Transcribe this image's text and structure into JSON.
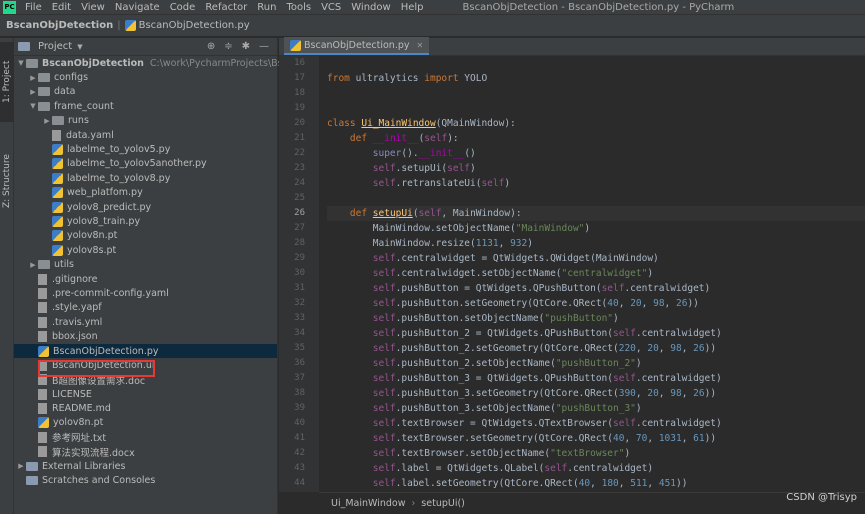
{
  "window": {
    "app_logo": "PC",
    "menu": [
      "File",
      "Edit",
      "View",
      "Navigate",
      "Code",
      "Refactor",
      "Run",
      "Tools",
      "VCS",
      "Window",
      "Help"
    ],
    "title": "BscanObjDetection - BscanObjDetection.py - PyCharm"
  },
  "breadcrumb": {
    "project": "BscanObjDetection",
    "file": "BscanObjDetection.py"
  },
  "side_tabs": {
    "project": "1: Project",
    "structure": "Z: Structure"
  },
  "project_panel": {
    "title": "Project",
    "root": {
      "name": "BscanObjDetection",
      "path": "C:\\work\\PycharmProjects\\BscanOb"
    },
    "items": [
      {
        "label": "configs",
        "type": "folder",
        "depth": 1,
        "expanded": false
      },
      {
        "label": "data",
        "type": "folder",
        "depth": 1,
        "expanded": false
      },
      {
        "label": "frame_count",
        "type": "folder",
        "depth": 1,
        "expanded": true
      },
      {
        "label": "runs",
        "type": "folder",
        "depth": 2,
        "expanded": false
      },
      {
        "label": "data.yaml",
        "type": "file",
        "depth": 2
      },
      {
        "label": "labelme_to_yolov5.py",
        "type": "py",
        "depth": 2
      },
      {
        "label": "labelme_to_yolov5another.py",
        "type": "py",
        "depth": 2
      },
      {
        "label": "labelme_to_yolov8.py",
        "type": "py",
        "depth": 2
      },
      {
        "label": "web_platfom.py",
        "type": "py",
        "depth": 2
      },
      {
        "label": "yolov8_predict.py",
        "type": "py",
        "depth": 2
      },
      {
        "label": "yolov8_train.py",
        "type": "py",
        "depth": 2
      },
      {
        "label": "yolov8n.pt",
        "type": "py",
        "depth": 2
      },
      {
        "label": "yolov8s.pt",
        "type": "py",
        "depth": 2
      },
      {
        "label": "utils",
        "type": "folder",
        "depth": 1,
        "expanded": false
      },
      {
        "label": ".gitignore",
        "type": "file",
        "depth": 1
      },
      {
        "label": ".pre-commit-config.yaml",
        "type": "file",
        "depth": 1
      },
      {
        "label": ".style.yapf",
        "type": "file",
        "depth": 1
      },
      {
        "label": ".travis.yml",
        "type": "file",
        "depth": 1
      },
      {
        "label": "bbox.json",
        "type": "file",
        "depth": 1
      },
      {
        "label": "BscanObjDetection.py",
        "type": "py",
        "depth": 1,
        "selected": true
      },
      {
        "label": "BscanObjDetection.ui",
        "type": "file",
        "depth": 1
      },
      {
        "label": "B超图像设置需求.doc",
        "type": "file",
        "depth": 1
      },
      {
        "label": "LICENSE",
        "type": "file",
        "depth": 1
      },
      {
        "label": "README.md",
        "type": "file",
        "depth": 1
      },
      {
        "label": "yolov8n.pt",
        "type": "py",
        "depth": 1
      },
      {
        "label": "参考网址.txt",
        "type": "file",
        "depth": 1
      },
      {
        "label": "算法实现流程.docx",
        "type": "file",
        "depth": 1
      },
      {
        "label": "External Libraries",
        "type": "lib",
        "depth": 0,
        "expanded": false
      },
      {
        "label": "Scratches and Consoles",
        "type": "scratch",
        "depth": 0
      }
    ]
  },
  "editor": {
    "tab": "BscanObjDetection.py",
    "current_line": 26,
    "line_numbers": [
      16,
      17,
      18,
      19,
      20,
      21,
      22,
      23,
      24,
      25,
      26,
      27,
      28,
      29,
      30,
      31,
      32,
      33,
      34,
      35,
      36,
      37,
      38,
      39,
      40,
      41,
      42,
      43,
      44
    ],
    "code_lines": [
      "",
      "from ultralytics import YOLO",
      "",
      "",
      "class Ui_MainWindow(QMainWindow):",
      "    def __init__(self):",
      "        super().__init__()",
      "        self.setupUi(self)",
      "        self.retranslateUi(self)",
      "",
      "    def setupUi(self, MainWindow):",
      "        MainWindow.setObjectName(\"MainWindow\")",
      "        MainWindow.resize(1131, 932)",
      "        self.centralwidget = QtWidgets.QWidget(MainWindow)",
      "        self.centralwidget.setObjectName(\"centralwidget\")",
      "        self.pushButton = QtWidgets.QPushButton(self.centralwidget)",
      "        self.pushButton.setGeometry(QtCore.QRect(40, 20, 98, 26))",
      "        self.pushButton.setObjectName(\"pushButton\")",
      "        self.pushButton_2 = QtWidgets.QPushButton(self.centralwidget)",
      "        self.pushButton_2.setGeometry(QtCore.QRect(220, 20, 98, 26))",
      "        self.pushButton_2.setObjectName(\"pushButton_2\")",
      "        self.pushButton_3 = QtWidgets.QPushButton(self.centralwidget)",
      "        self.pushButton_3.setGeometry(QtCore.QRect(390, 20, 98, 26))",
      "        self.pushButton_3.setObjectName(\"pushButton_3\")",
      "        self.textBrowser = QtWidgets.QTextBrowser(self.centralwidget)",
      "        self.textBrowser.setGeometry(QtCore.QRect(40, 70, 1031, 61))",
      "        self.textBrowser.setObjectName(\"textBrowser\")",
      "        self.label = QtWidgets.QLabel(self.centralwidget)",
      "        self.label.setGeometry(QtCore.QRect(40, 180, 511, 451))"
    ]
  },
  "status": {
    "class": "Ui_MainWindow",
    "method": "setupUi()",
    "separator": "›"
  },
  "watermark": "CSDN @Trisyp",
  "colors": {
    "keyword": "#cc7832",
    "self": "#94558d",
    "string": "#6a8759",
    "number": "#6897bb",
    "selection": "#e53935"
  }
}
